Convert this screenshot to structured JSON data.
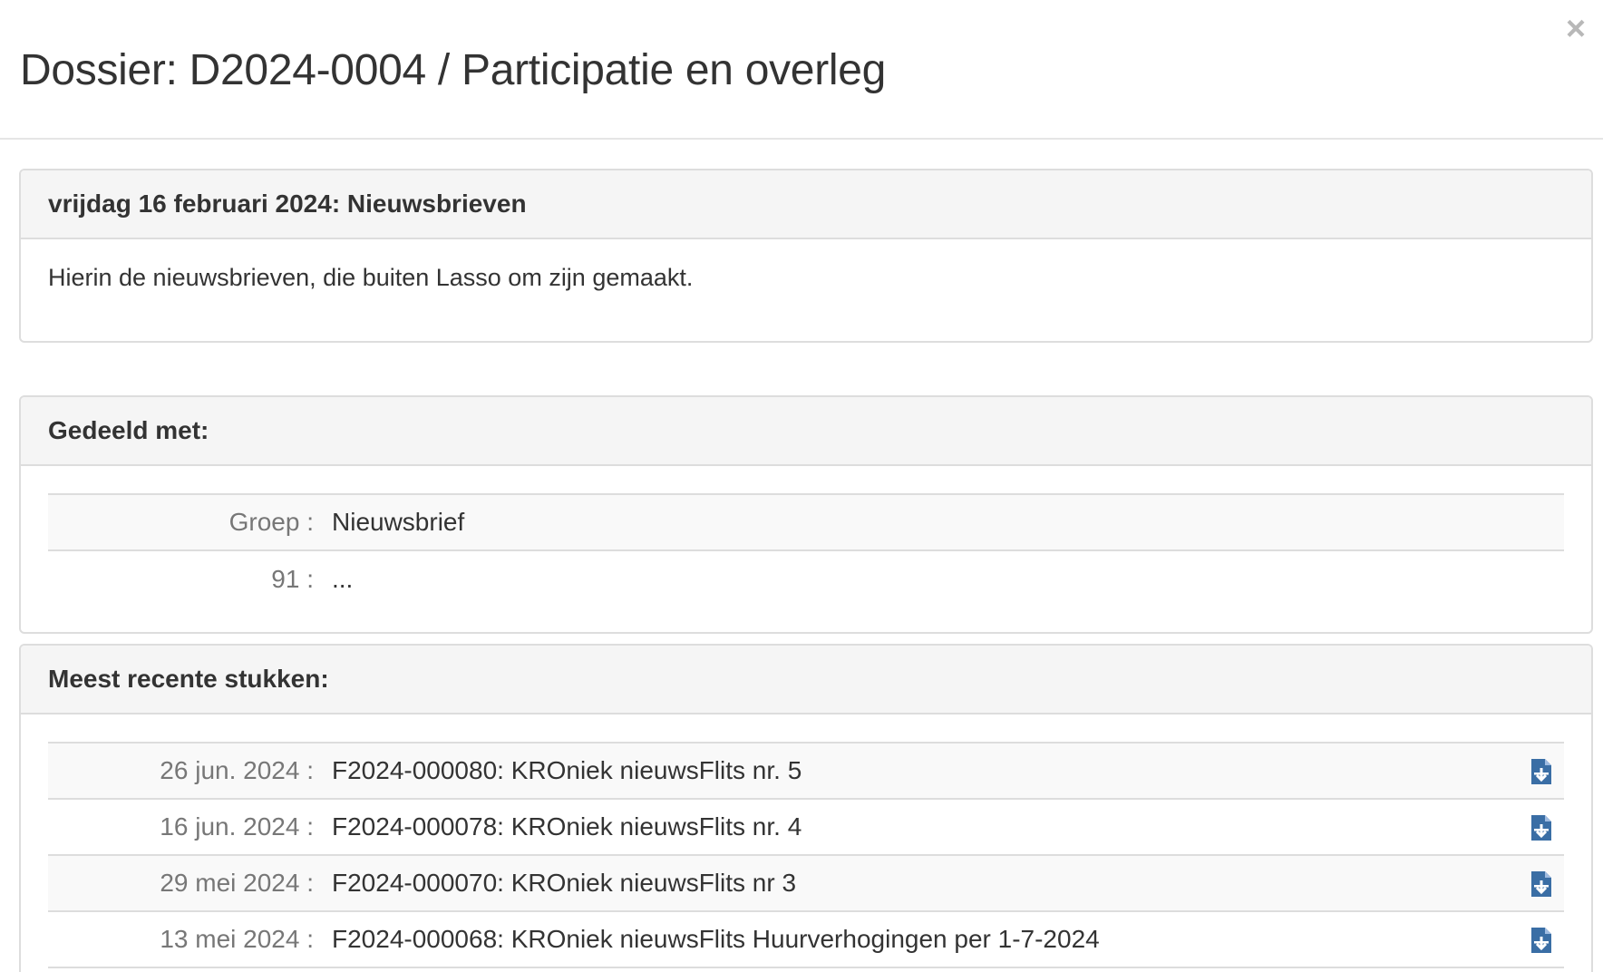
{
  "modal": {
    "title": "Dossier: D2024-0004 / Participatie en overleg",
    "close_label": "×"
  },
  "event_panel": {
    "heading": "vrijdag 16 februari 2024: Nieuwsbrieven",
    "description": "Hierin de nieuwsbrieven, die buiten Lasso om zijn gemaakt."
  },
  "shared_panel": {
    "heading": "Gedeeld met:",
    "rows": [
      {
        "key": "Groep :",
        "value": "Nieuwsbrief"
      },
      {
        "key": "91 :",
        "value": "..."
      }
    ]
  },
  "recent_panel": {
    "heading": "Meest recente stukken:",
    "rows": [
      {
        "date": "26 jun. 2024 :",
        "title": "F2024-000080: KROniek nieuwsFlits nr. 5",
        "icon": "file-download-icon"
      },
      {
        "date": "16 jun. 2024 :",
        "title": "F2024-000078: KROniek nieuwsFlits nr. 4",
        "icon": "file-download-icon"
      },
      {
        "date": "29 mei 2024 :",
        "title": "F2024-000070: KROniek nieuwsFlits nr 3",
        "icon": "file-download-icon"
      },
      {
        "date": "13 mei 2024 :",
        "title": "F2024-000068: KROniek nieuwsFlits Huurverhogingen per 1-7-2024",
        "icon": "file-download-icon"
      }
    ]
  },
  "colors": {
    "icon_blue": "#3a6ea5",
    "muted_text": "#777777",
    "border": "#dddddd",
    "heading_bg": "#f5f5f5"
  }
}
